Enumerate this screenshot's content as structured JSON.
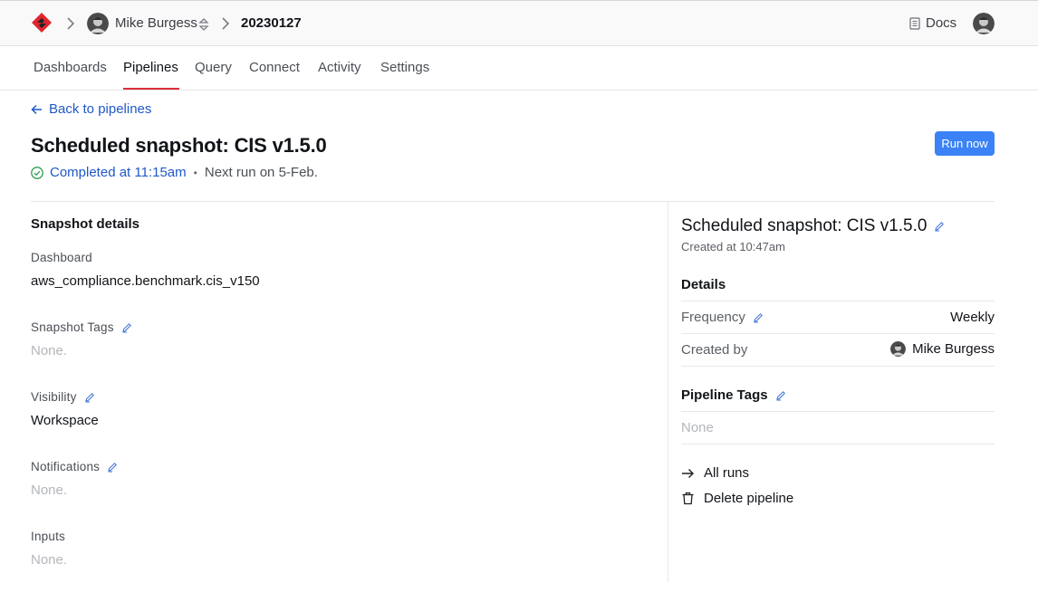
{
  "header": {
    "user_name": "Mike Burgess",
    "current_crumb": "20230127",
    "docs_label": "Docs"
  },
  "tabs": [
    {
      "label": "Dashboards"
    },
    {
      "label": "Pipelines"
    },
    {
      "label": "Query"
    },
    {
      "label": "Connect"
    },
    {
      "label": "Activity"
    },
    {
      "label": "Settings"
    }
  ],
  "active_tab": "Pipelines",
  "page": {
    "back_label": "Back to pipelines",
    "title": "Scheduled snapshot: CIS v1.5.0",
    "status_text": "Completed at 11:15am",
    "next_run": "Next run on 5-Feb.",
    "run_button": "Run now"
  },
  "snapshot_details": {
    "heading": "Snapshot details",
    "dashboard_label": "Dashboard",
    "dashboard_value": "aws_compliance.benchmark.cis_v150",
    "tags_label": "Snapshot Tags",
    "tags_value": "None.",
    "visibility_label": "Visibility",
    "visibility_value": "Workspace",
    "notifications_label": "Notifications",
    "notifications_value": "None.",
    "inputs_label": "Inputs",
    "inputs_value": "None."
  },
  "right_panel": {
    "title": "Scheduled snapshot: CIS v1.5.0",
    "created_at": "Created at 10:47am",
    "details_heading": "Details",
    "frequency_label": "Frequency",
    "frequency_value": "Weekly",
    "created_by_label": "Created by",
    "created_by_value": "Mike Burgess",
    "pipeline_tags_heading": "Pipeline Tags",
    "pipeline_tags_value": "None",
    "all_runs_label": "All runs",
    "delete_label": "Delete pipeline"
  },
  "colors": {
    "accent_blue": "#3b82f6",
    "link_blue": "#1f59c7",
    "active_tab_underline": "#dc2f3a",
    "success_green": "#2e9e4f",
    "logo_red": "#e0262f"
  },
  "icons": [
    "logo-icon",
    "chevron-right-icon",
    "user-avatar",
    "switch-icon",
    "docs-icon",
    "arrow-left-icon",
    "check-circle-icon",
    "pencil-icon",
    "arrow-right-icon",
    "trash-icon"
  ]
}
